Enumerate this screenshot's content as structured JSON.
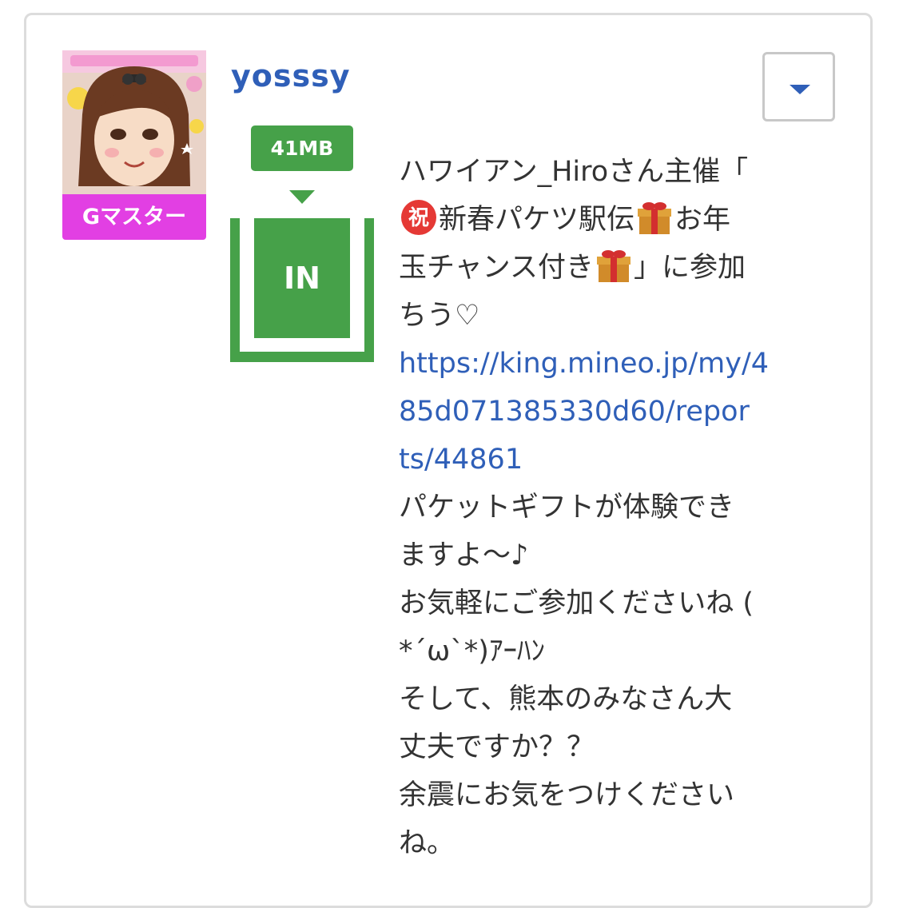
{
  "user": {
    "name": "yosssy",
    "rank_badge": "Gマスター"
  },
  "gauge": {
    "amount": "41MB",
    "direction": "IN",
    "fill_level": 0.83,
    "color": "#46a149"
  },
  "post": {
    "line1": "ハワイアン_Hiroさん主催「",
    "line2_text": "新春パケツ駅伝",
    "line2_tail": "お年",
    "line3_text": "玉チャンス付き",
    "line3_tail": "」に参加",
    "line4": "ちう♡",
    "link_part1": "https://king.mineo.jp/my/4",
    "link_part2": "85d071385330d60/repor",
    "link_part3": "ts/44861",
    "line5": "パケットギフトが体験でき",
    "line6": "ますよ〜♪",
    "line7": "お気軽にご参加くださいね (",
    "line8": "*´ω`*)ｱｰﾊﾝ",
    "line9": "そして、熊本のみなさん大",
    "line10": "丈夫ですか？？",
    "line11": "余震にお気をつけください",
    "line12": "ね。"
  },
  "icons": {
    "dropdown": "chevron-down-icon",
    "emoji_celebrate": "congratulation-emoji-icon",
    "emoji_gift": "gift-emoji-icon"
  },
  "colors": {
    "username": "#2f5fb8",
    "badge": "#e23fe3",
    "link": "#2f5fb8",
    "gauge": "#46a149"
  }
}
